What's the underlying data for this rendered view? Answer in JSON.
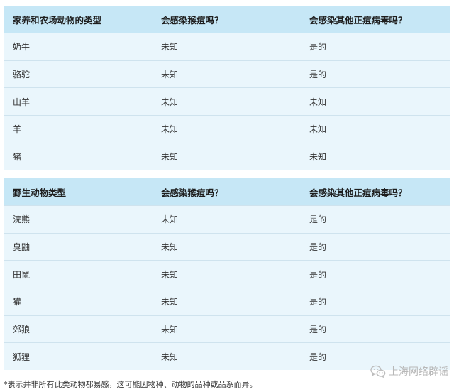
{
  "farm_table": {
    "headers": [
      "家养和农场动物的类型",
      "会感染猴痘吗？",
      "会感染其他正痘病毒吗？"
    ],
    "rows": [
      [
        "奶牛",
        "未知",
        "是的"
      ],
      [
        "骆驼",
        "未知",
        "是的"
      ],
      [
        "山羊",
        "未知",
        "未知"
      ],
      [
        "羊",
        "未知",
        "未知"
      ],
      [
        "猪",
        "未知",
        "未知"
      ]
    ]
  },
  "wild_table": {
    "headers": [
      "野生动物类型",
      "会感染猴痘吗？",
      "会感染其他正痘病毒吗？"
    ],
    "rows": [
      [
        "浣熊",
        "未知",
        "是的"
      ],
      [
        "臭鼬",
        "未知",
        "是的"
      ],
      [
        "田鼠",
        "未知",
        "是的"
      ],
      [
        "獾",
        "未知",
        "是的"
      ],
      [
        "郊狼",
        "未知",
        "是的"
      ],
      [
        "狐狸",
        "未知",
        "是的"
      ]
    ]
  },
  "footnote": "*表示并非所有此类动物都易感，这可能因物种、动物的品种或品系而异。",
  "watermark": {
    "text": "上海网络辟谣",
    "icon": "wechat-icon"
  },
  "colors": {
    "header_bg": "#c6e7f6",
    "row_bg": "#eaf6fc",
    "divider": "#cfe3ee"
  }
}
